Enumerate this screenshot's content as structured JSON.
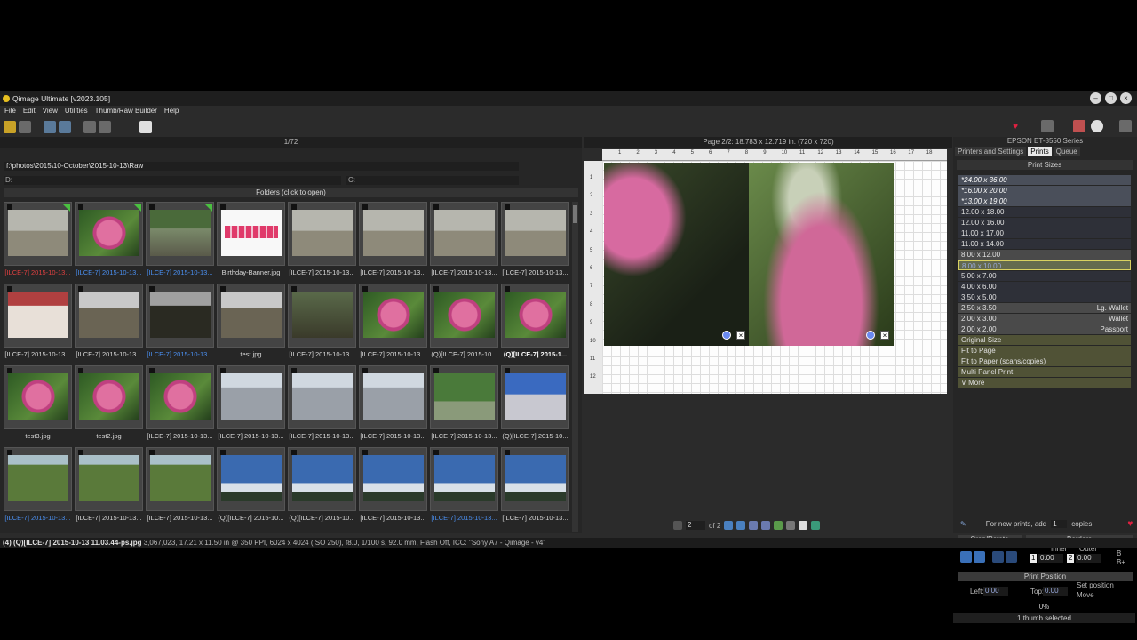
{
  "window": {
    "title": "Qimage Ultimate [v2023.105]"
  },
  "menu": [
    "File",
    "Edit",
    "View",
    "Utilities",
    "Thumb/Raw Builder",
    "Help"
  ],
  "left": {
    "count": "1/72",
    "path": "f:\\photos\\2015\\10-October\\2015-10-13\\Raw",
    "d_label": "D:",
    "c_label": "C:",
    "folders_label": "Folders (click to open)"
  },
  "thumbs": [
    {
      "cap": "[ILCE-7] 2015-10-13...",
      "style": "red",
      "img": "dog",
      "flag": true
    },
    {
      "cap": "[ILCE-7] 2015-10-13...",
      "style": "blue",
      "img": "flower",
      "flag": true
    },
    {
      "cap": "[ILCE-7] 2015-10-13...",
      "style": "blue",
      "img": "patio",
      "flag": true
    },
    {
      "cap": "Birthday-Banner.jpg",
      "style": "",
      "img": "banner",
      "flag": false
    },
    {
      "cap": "[ILCE-7] 2015-10-13...",
      "style": "",
      "img": "dog",
      "flag": false
    },
    {
      "cap": "[ILCE-7] 2015-10-13...",
      "style": "",
      "img": "dog",
      "flag": false
    },
    {
      "cap": "[ILCE-7] 2015-10-13...",
      "style": "",
      "img": "dog",
      "flag": false
    },
    {
      "cap": "[ILCE-7] 2015-10-13...",
      "style": "",
      "img": "dog",
      "flag": false
    },
    {
      "cap": "[ILCE-7] 2015-10-13...",
      "style": "",
      "img": "store",
      "flag": false
    },
    {
      "cap": "[ILCE-7] 2015-10-13...",
      "style": "",
      "img": "building",
      "flag": false
    },
    {
      "cap": "[ILCE-7] 2015-10-13...",
      "style": "blue",
      "img": "dark",
      "flag": false
    },
    {
      "cap": "test.jpg",
      "style": "",
      "img": "building",
      "flag": false
    },
    {
      "cap": "[ILCE-7] 2015-10-13...",
      "style": "",
      "img": "path",
      "flag": false
    },
    {
      "cap": "[ILCE-7] 2015-10-13...",
      "style": "",
      "img": "flower",
      "flag": false
    },
    {
      "cap": "(Q)[ILCE-7] 2015-10...",
      "style": "",
      "img": "flower",
      "flag": false
    },
    {
      "cap": "(Q)[ILCE-7] 2015-1...",
      "style": "bold",
      "img": "flower",
      "flag": false
    },
    {
      "cap": "test3.jpg",
      "style": "",
      "img": "flower",
      "flag": false
    },
    {
      "cap": "test2.jpg",
      "style": "",
      "img": "flower",
      "flag": false
    },
    {
      "cap": "[ILCE-7] 2015-10-13...",
      "style": "",
      "img": "flower",
      "flag": false
    },
    {
      "cap": "[ILCE-7] 2015-10-13...",
      "style": "",
      "img": "tower",
      "flag": false
    },
    {
      "cap": "[ILCE-7] 2015-10-13...",
      "style": "",
      "img": "tower",
      "flag": false
    },
    {
      "cap": "[ILCE-7] 2015-10-13...",
      "style": "",
      "img": "tower",
      "flag": false
    },
    {
      "cap": "[ILCE-7] 2015-10-13...",
      "style": "",
      "img": "horse",
      "flag": false
    },
    {
      "cap": "(Q)[ILCE-7] 2015-10...",
      "style": "",
      "img": "castle",
      "flag": false
    },
    {
      "cap": "[ILCE-7] 2015-10-13...",
      "style": "blue",
      "img": "bridge",
      "flag": false
    },
    {
      "cap": "[ILCE-7] 2015-10-13...",
      "style": "",
      "img": "bridge",
      "flag": false
    },
    {
      "cap": "[ILCE-7] 2015-10-13...",
      "style": "",
      "img": "bridge",
      "flag": false
    },
    {
      "cap": "(Q)[ILCE-7] 2015-10...",
      "style": "",
      "img": "sky",
      "flag": false
    },
    {
      "cap": "(Q)[ILCE-7] 2015-10...",
      "style": "",
      "img": "sky",
      "flag": false
    },
    {
      "cap": "[ILCE-7] 2015-10-13...",
      "style": "",
      "img": "sky",
      "flag": false
    },
    {
      "cap": "[ILCE-7] 2015-10-13...",
      "style": "blue",
      "img": "sky",
      "flag": false
    },
    {
      "cap": "[ILCE-7] 2015-10-13...",
      "style": "",
      "img": "sky",
      "flag": false
    }
  ],
  "status": {
    "file": "(4) (Q)[ILCE-7] 2015-10-13 11.03.44-ps.jpg",
    "info": "3,067,023, 17.21 x 11.50 in @ 350 PPI, 6024 x 4024 (ISO 250), f8.0, 1/100 s, 92.0 mm, Flash Off, ICC: \"Sony A7 - Qimage - v4\""
  },
  "center": {
    "page_info": "Page 2/2: 18.783 x 12.719 in. (720 x 720)",
    "ruler_top": [
      "1",
      "2",
      "3",
      "4",
      "5",
      "6",
      "7",
      "8",
      "9",
      "10",
      "11",
      "12",
      "13",
      "14",
      "15",
      "16",
      "17",
      "18"
    ],
    "ruler_left": [
      "1",
      "2",
      "3",
      "4",
      "5",
      "6",
      "7",
      "8",
      "9",
      "10",
      "11",
      "12"
    ],
    "page_value": "2",
    "of_label": "of 2"
  },
  "right": {
    "printer": "EPSON ET-8550 Series",
    "tabs": [
      "Printers and Settings",
      "Prints",
      "Queue"
    ],
    "print_sizes_title": "Print Sizes",
    "sizes": [
      {
        "label": "*24.00 x 36.00",
        "right": "",
        "style": "italic"
      },
      {
        "label": "*16.00 x 20.00",
        "right": "",
        "style": "italic"
      },
      {
        "label": "*13.00 x 19.00",
        "right": "",
        "style": "italic"
      },
      {
        "label": "12.00 x 18.00",
        "right": "",
        "style": "dark"
      },
      {
        "label": "12.00 x 16.00",
        "right": "",
        "style": "dark"
      },
      {
        "label": "11.00 x 17.00",
        "right": "",
        "style": "dark"
      },
      {
        "label": "11.00 x 14.00",
        "right": "",
        "style": "dark"
      },
      {
        "label": "8.00 x 12.00",
        "right": "",
        "style": "mid"
      },
      {
        "label": "8.00 x 10.00",
        "right": "",
        "style": "sel"
      },
      {
        "label": "5.00 x 7.00",
        "right": "",
        "style": "dark"
      },
      {
        "label": "4.00 x 6.00",
        "right": "",
        "style": "dark"
      },
      {
        "label": "3.50 x 5.00",
        "right": "",
        "style": "dark"
      },
      {
        "label": "2.50 x 3.50",
        "right": "Lg. Wallet",
        "style": "mid"
      },
      {
        "label": "2.00 x 3.00",
        "right": "Wallet",
        "style": "mid"
      },
      {
        "label": "2.00 x 2.00",
        "right": "Passport",
        "style": "mid"
      },
      {
        "label": "Original Size",
        "right": "",
        "style": "olive"
      },
      {
        "label": "Fit to Page",
        "right": "",
        "style": "olive"
      },
      {
        "label": "Fit to Paper (scans/copies)",
        "right": "",
        "style": "olive"
      },
      {
        "label": "Multi Panel Print",
        "right": "",
        "style": "olive"
      },
      {
        "label": "∨ More",
        "right": "",
        "style": "olive"
      }
    ],
    "copies_prefix": "For new prints, add",
    "copies_value": "1",
    "copies_suffix": "copies",
    "crop_rotate": "Crop/Rotate",
    "borders": "Borders",
    "inner_label": "Inner",
    "outer_label": "Outer",
    "inner_num": "1",
    "inner_value": "0.00",
    "outer_num": "2",
    "outer_value": "0.00",
    "b_label": "B",
    "bplus_label": "B+",
    "print_position": "Print Position",
    "left_label": "Left:",
    "left_value": "0.00",
    "top_label": "Top:",
    "top_value": "0.00",
    "set_position": "Set position",
    "move": "Move",
    "progress": "0%",
    "selected": "1 thumb selected"
  }
}
